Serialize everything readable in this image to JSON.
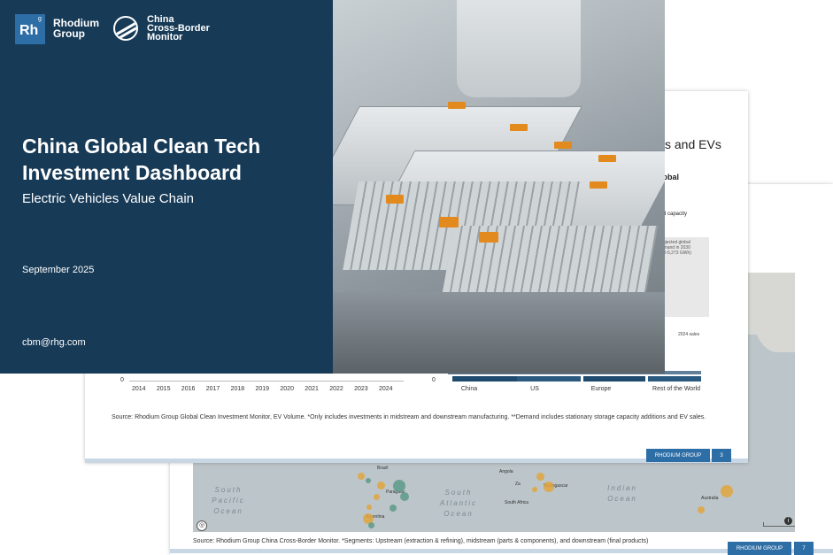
{
  "slide7": {
    "source": "Source: Rhodium Group China Cross-Border Monitor. *Segments: Upstream (extraction & refining), midstream (parts & components), and downstream (final products)",
    "footer_org": "RHODIUM GROUP",
    "page_number": "7",
    "map": {
      "oceans": {
        "south_pacific": "South\nPacific\nOcean",
        "south_atlantic": "South\nAtlantic\nOcean",
        "indian": "Indian\nOcean"
      },
      "labels": {
        "brazil": "Brazil",
        "angola": "Angola",
        "madagascar": "Madagascar",
        "paraguay": "Paraguay",
        "argentina": "Argentina",
        "south_africa": "South Africa",
        "australia": "Australia",
        "zambia": "Za"
      }
    }
  },
  "slide3": {
    "title_partial": "s and EVs",
    "subtitle_partial": "lobal",
    "label_partial": "ted capacity",
    "annotation": "Projected global\ndemand in 2030\n410-5,273 GWh)",
    "legend_partial": "2024 sales",
    "left_chart": {
      "zero": "0",
      "years": [
        "2014",
        "2015",
        "2016",
        "2017",
        "2018",
        "2019",
        "2020",
        "2021",
        "2022",
        "2023",
        "2024"
      ]
    },
    "right_chart": {
      "zero": "0",
      "regions": [
        "China",
        "US",
        "Europe",
        "Rest of the World"
      ]
    },
    "source": "Source: Rhodium Group Global Clean Investment Monitor, EV Volume. *Only includes investments in midstream and downstream manufacturing. **Demand includes stationary storage capacity additions and EV sales.",
    "footer_org": "RHODIUM GROUP",
    "page_number": "3"
  },
  "cover": {
    "rh_logo_text": "Rh",
    "rh_superscript": "g",
    "org_name_line1": "Rhodium",
    "org_name_line2": "Group",
    "cbm_line1": "China",
    "cbm_line2": "Cross-Border",
    "cbm_line3": "Monitor",
    "title_line1": "China Global Clean Tech",
    "title_line2": "Investment Dashboard",
    "subtitle": "Electric Vehicles Value Chain",
    "date": "September 2025",
    "email": "cbm@rhg.com"
  },
  "colors": {
    "navy": "#173a57",
    "accent_blue": "#2e6ea6",
    "bar_navy": "#1e4a6e",
    "dot_gold": "#e0a640",
    "dot_teal": "#5d9a88"
  }
}
